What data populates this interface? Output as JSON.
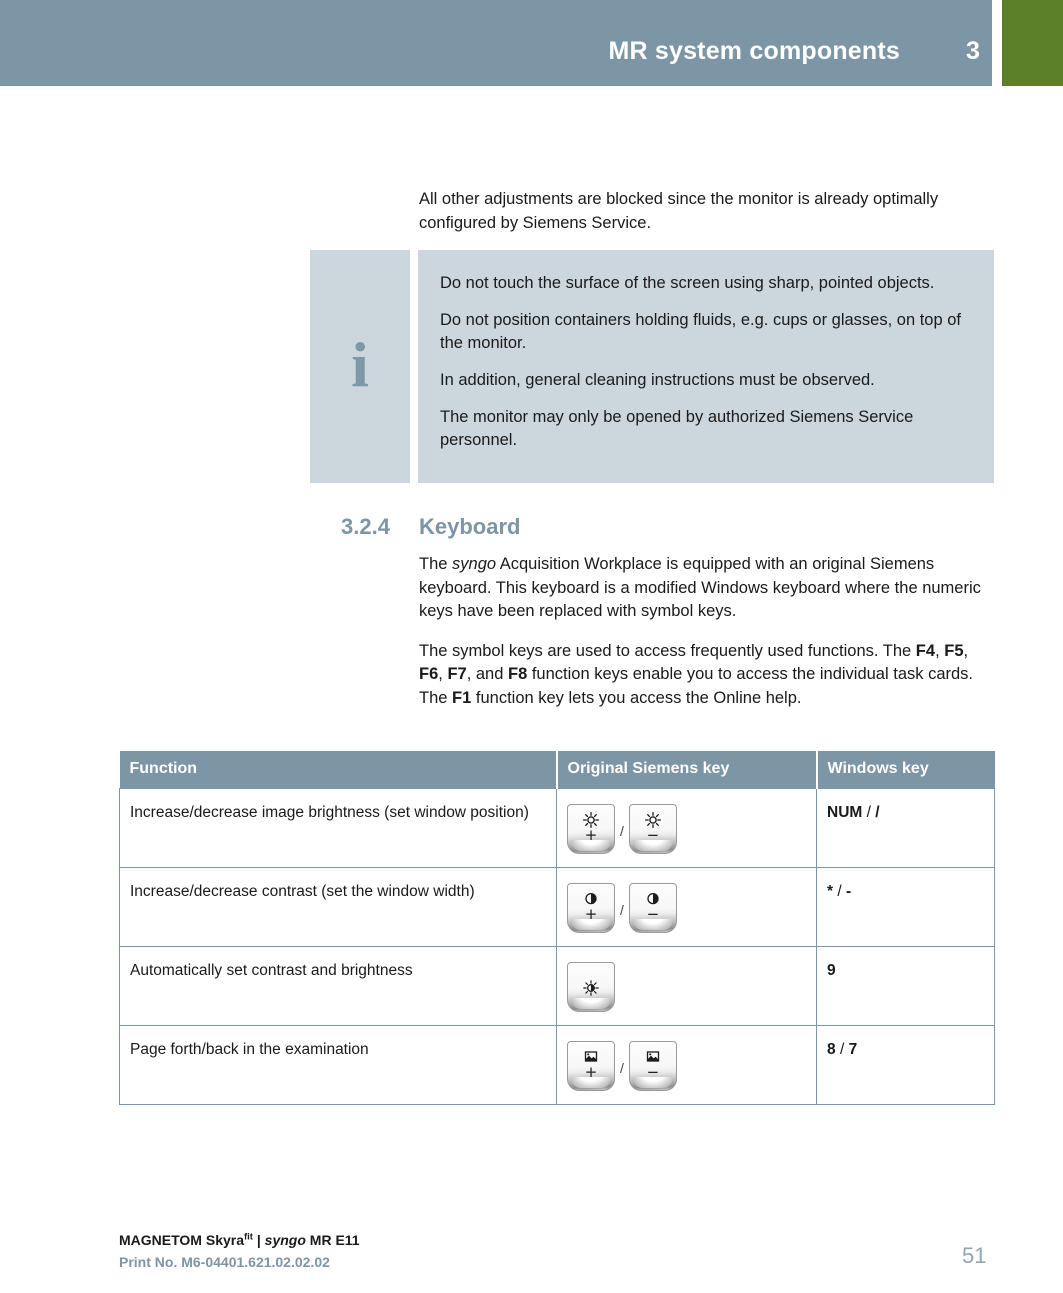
{
  "header": {
    "title": "MR system components",
    "chapter": "3",
    "tab_color": "#5b8029",
    "band_color": "#7d96a5"
  },
  "intro": {
    "paragraph": "All other adjustments are blocked since the monitor is already optimally configured by Siemens Service."
  },
  "note": {
    "icon": "info-i",
    "lines": [
      "Do not touch the surface of the screen using sharp, pointed objects.",
      "Do not position containers holding fluids, e.g. cups or glasses, on top of the monitor.",
      "In addition, general cleaning instructions must be observed.",
      "The monitor may only be opened by authorized Siemens Service personnel."
    ],
    "background_color": "#ccd7dd",
    "icon_color": "#7d99a8"
  },
  "section": {
    "number": "3.2.4",
    "title": "Keyboard",
    "color": "#7d96a5",
    "paragraph1_part1": "The ",
    "paragraph1_italic": "syngo",
    "paragraph1_part2": " Acquisition Workplace is equipped with an original Siemens keyboard. This keyboard is a modified Windows keyboard where the numeric keys have been replaced with symbol keys.",
    "paragraph2_part1": "The symbol keys are used to access frequently used functions. The ",
    "paragraph2_f4": "F4",
    "paragraph2_sep1": ", ",
    "paragraph2_f5": "F5",
    "paragraph2_sep2": ", ",
    "paragraph2_f6": "F6",
    "paragraph2_sep3": ", ",
    "paragraph2_f7": "F7",
    "paragraph2_sep4": ", and ",
    "paragraph2_f8": "F8",
    "paragraph2_part2": " function keys enable you to access the individual task cards. The ",
    "paragraph2_f1": "F1",
    "paragraph2_part3": " function key lets you access the Online help."
  },
  "table": {
    "columns": [
      "Function",
      "Original Siemens key",
      "Windows key"
    ],
    "rows": [
      {
        "function": "Increase/decrease image brightness (set window position)",
        "keys": [
          {
            "glyph": "brightness-sun-icon",
            "sign": "+"
          },
          {
            "glyph": "brightness-sun-icon",
            "sign": "−"
          }
        ],
        "key_separator": "/",
        "windows_key_a": "NUM",
        "windows_key_sep": "/",
        "windows_key_b": "/"
      },
      {
        "function": "Increase/decrease contrast (set the window width)",
        "keys": [
          {
            "glyph": "contrast-half-circle-icon",
            "sign": "+"
          },
          {
            "glyph": "contrast-half-circle-icon",
            "sign": "−"
          }
        ],
        "key_separator": "/",
        "windows_key_a": "*",
        "windows_key_sep": "/",
        "windows_key_b": "-"
      },
      {
        "function": "Automatically set contrast and brightness",
        "keys": [
          {
            "glyph": "auto-contrast-brightness-icon",
            "sign": ""
          }
        ],
        "key_separator": "",
        "windows_key_a": "9",
        "windows_key_sep": "",
        "windows_key_b": ""
      },
      {
        "function": "Page forth/back in the examination",
        "keys": [
          {
            "glyph": "image-page-icon",
            "sign": "+"
          },
          {
            "glyph": "image-page-icon",
            "sign": "−"
          }
        ],
        "key_separator": "/",
        "windows_key_a": "8",
        "windows_key_sep": "/",
        "windows_key_b": "7"
      }
    ]
  },
  "footer": {
    "product": "MAGNETOM Skyra",
    "product_sup": "fit",
    "product_sep": " | ",
    "syngo": "syngo",
    "product_tail": " MR E11",
    "print_no": "Print No. M6-04401.621.02.02.02",
    "page_number": "51"
  }
}
